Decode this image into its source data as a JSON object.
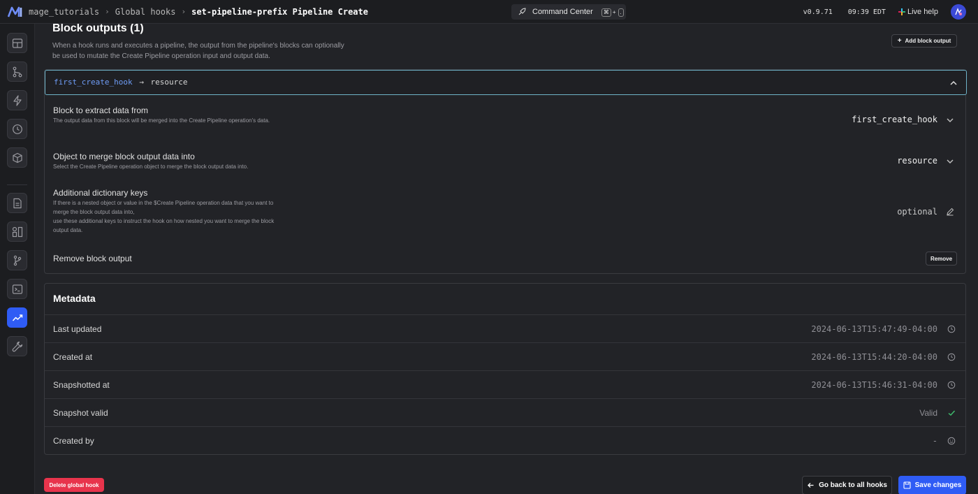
{
  "header": {
    "breadcrumbs": [
      "mage_tutorials",
      "Global hooks",
      "set-pipeline-prefix Pipeline Create"
    ],
    "command_center": "Command Center",
    "shortcut_keys": [
      "⌘",
      "+",
      "."
    ],
    "version": "v0.9.71",
    "time": "09:39 EDT",
    "live_help": "Live help"
  },
  "sidebar": {
    "items": [
      "layout-icon",
      "pipeline-tree-icon",
      "lightning-icon",
      "clock-icon",
      "cube-icon",
      "document-icon",
      "dashboard-icon",
      "git-branch-icon",
      "terminal-icon",
      "chart-trend-icon",
      "wrench-icon"
    ],
    "active_item": "chart-trend-icon"
  },
  "block_outputs": {
    "title": "Block outputs (1)",
    "description": "When a hook runs and executes a pipeline, the output from the pipeline's blocks can optionally be used to mutate the Create Pipeline operation input and output data.",
    "add_button": "Add block output",
    "item": {
      "block": "first_create_hook",
      "arrow": "→",
      "target": "resource",
      "rows": {
        "block_label": "Block to extract data from",
        "block_desc": "The output data from this block will be merged into the Create Pipeline operation's data.",
        "block_value": "first_create_hook",
        "object_label": "Object to merge block output data into",
        "object_desc": "Select the Create Pipeline operation object to merge the block output data into.",
        "object_value": "resource",
        "keys_label": "Additional dictionary keys",
        "keys_desc_1": "If there is a nested object or value in the $Create Pipeline operation data that you want to merge the block output data into,",
        "keys_desc_2": "use these additional keys to instruct the hook on how nested you want to merge the block output data.",
        "keys_value": "optional",
        "remove_label": "Remove block output",
        "remove_button": "Remove"
      }
    }
  },
  "metadata": {
    "title": "Metadata",
    "rows": [
      {
        "label": "Last updated",
        "value": "2024-06-13T15:47:49-04:00",
        "icon": "clock-icon"
      },
      {
        "label": "Created at",
        "value": "2024-06-13T15:44:20-04:00",
        "icon": "clock-icon"
      },
      {
        "label": "Snapshotted at",
        "value": "2024-06-13T15:46:31-04:00",
        "icon": "clock-icon"
      },
      {
        "label": "Snapshot valid",
        "value": "Valid",
        "icon": "check-icon"
      },
      {
        "label": "Created by",
        "value": "-",
        "icon": "smiley-icon"
      }
    ]
  },
  "footer": {
    "delete_button": "Delete global hook",
    "back_button": "Go back to all hooks",
    "save_button": "Save changes"
  },
  "colors": {
    "accent": "#2f5cf5",
    "danger": "#e8344c",
    "link": "#6f9df7",
    "valid": "#3fbf6f"
  }
}
